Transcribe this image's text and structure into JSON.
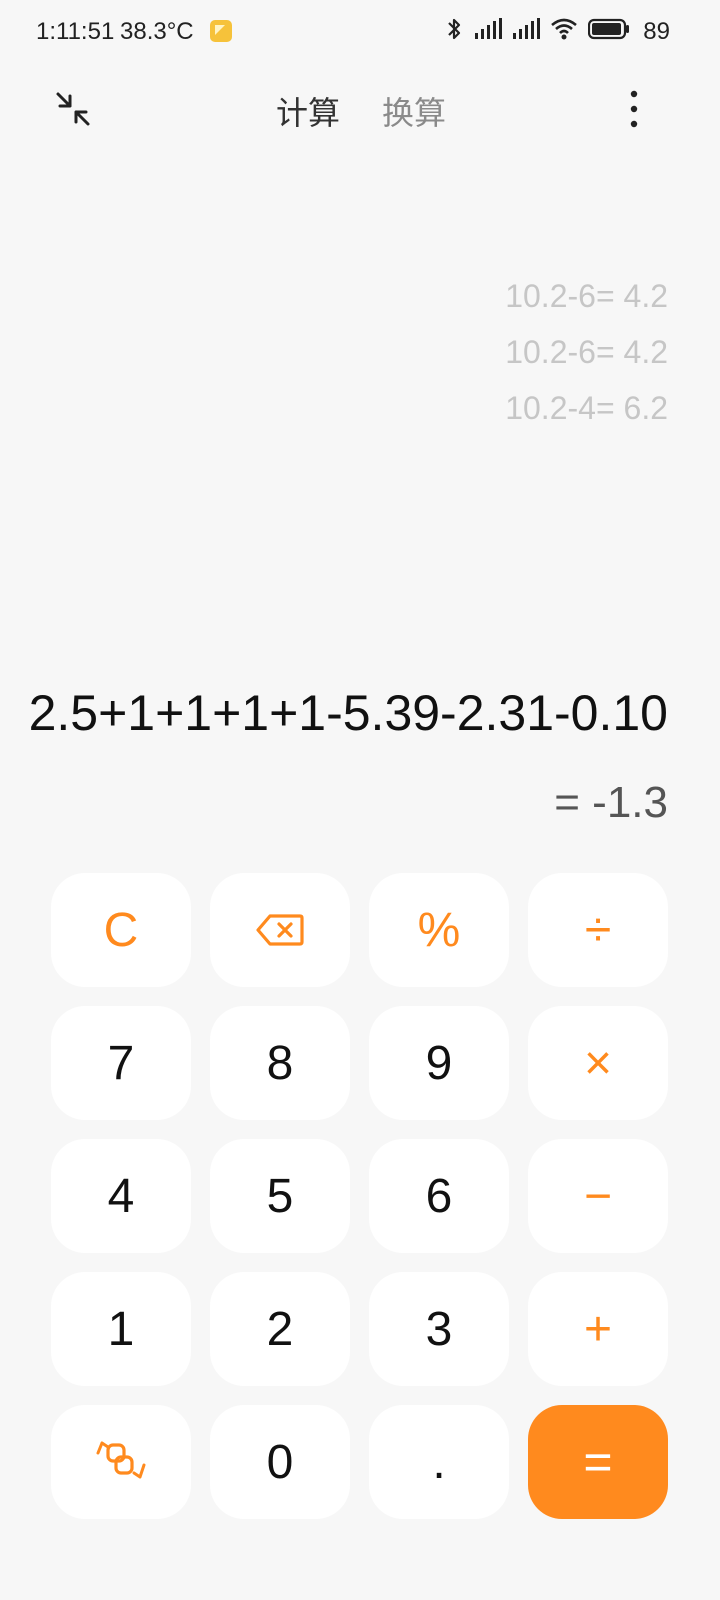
{
  "status_bar": {
    "time": "1:11:51",
    "temperature": "38.3°C",
    "battery": "89",
    "icons": [
      "bluetooth-icon",
      "signal-icon",
      "signal-icon",
      "wifi-icon",
      "battery-icon"
    ]
  },
  "topbar": {
    "tab_calc": "计算",
    "tab_convert": "换算"
  },
  "history": [
    "10.2-6= 4.2",
    "10.2-6= 4.2",
    "10.2-4= 6.2"
  ],
  "display": {
    "expression": "2.5+1+1+1+1-5.39-2.31-0.10",
    "result": "= -1.3"
  },
  "keys": {
    "clear": "C",
    "percent": "%",
    "divide": "÷",
    "seven": "7",
    "eight": "8",
    "nine": "9",
    "multiply": "×",
    "four": "4",
    "five": "5",
    "six": "6",
    "minus": "−",
    "one": "1",
    "two": "2",
    "three": "3",
    "plus": "+",
    "zero": "0",
    "dot": ".",
    "equals": "="
  },
  "colors": {
    "accent": "#ff8a1e",
    "background": "#f7f7f7",
    "key_bg": "#ffffff"
  }
}
